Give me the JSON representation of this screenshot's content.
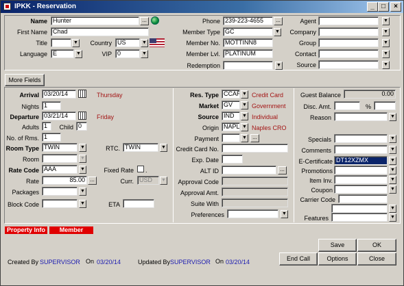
{
  "window": {
    "title": "IPKK - Reservation"
  },
  "profile": {
    "name_label": "Name",
    "name": "Hunter",
    "first_name_label": "First Name",
    "first_name": "Chad",
    "title_label": "Title",
    "title": "",
    "country_label": "Country",
    "country": "US",
    "language_label": "Language",
    "language": "E",
    "vip_label": "VIP",
    "vip": "0",
    "phone_label": "Phone",
    "phone": "239-223-4655",
    "member_type_label": "Member Type",
    "member_type": "GC",
    "member_no_label": "Member No.",
    "member_no": "MOTTINN8",
    "member_lvl_label": "Member Lvl.",
    "member_lvl": "PLATINUM",
    "redemption_label": "Redemption",
    "redemption": "",
    "agent_label": "Agent",
    "agent": "",
    "company_label": "Company",
    "company": "",
    "group_label": "Group",
    "group": "",
    "contact_label": "Contact",
    "contact": "",
    "source_label": "Source",
    "source": ""
  },
  "more_fields_label": "More Fields",
  "stay": {
    "arrival_label": "Arrival",
    "arrival": "03/20/14",
    "arrival_day": "Thursday",
    "nights_label": "Nights",
    "nights": "1",
    "departure_label": "Departure",
    "departure": "03/21/14",
    "departure_day": "Friday",
    "adults_label": "Adults",
    "adults": "1",
    "child_label": "Child",
    "child": "0",
    "rooms_label": "No. of Rms.",
    "rooms": "1",
    "room_type_label": "Room Type",
    "room_type": "TWIN",
    "rtc_label": "RTC.",
    "rtc": "TWIN",
    "room_label": "Room",
    "room": "",
    "rate_code_label": "Rate Code",
    "rate_code": "AAA",
    "fixed_rate_label": "Fixed Rate",
    "fixed_rate_suffix": ".",
    "rate_label": "Rate",
    "rate": "85.00",
    "curr_label": "Curr.",
    "curr": "USD",
    "packages_label": "Packages",
    "packages": "",
    "block_code_label": "Block Code",
    "block_code": "",
    "eta_label": "ETA",
    "eta": ""
  },
  "reservation": {
    "res_type_label": "Res. Type",
    "res_type": "CCAR",
    "res_type_desc": "Credit Card",
    "market_label": "Market",
    "market": "GV",
    "market_desc": "Government",
    "source_label": "Source",
    "source": "IND",
    "source_desc": "Individual",
    "origin_label": "Origin",
    "origin": "NAPL",
    "origin_desc": "Naples CRO",
    "payment_label": "Payment",
    "payment": "",
    "cc_label": "Credit Card No.",
    "cc": "",
    "exp_label": "Exp. Date",
    "exp": "",
    "alt_id_label": "ALT ID",
    "alt_id": "",
    "approval_code_label": "Approval Code",
    "approval_code": "",
    "approval_amt_label": "Approval Amt.",
    "approval_amt": "",
    "suite_with_label": "Suite With",
    "suite_with": "",
    "preferences_label": "Preferences",
    "preferences": ""
  },
  "right": {
    "guest_balance_label": "Guest Balance",
    "guest_balance": "0.00",
    "disc_amt_label": "Disc. Amt.",
    "disc_amt": "",
    "pct_label": "%",
    "pct": "",
    "reason_label": "Reason",
    "reason": "",
    "specials_label": "Specials",
    "specials": "",
    "comments_label": "Comments",
    "comments": "",
    "ecert_label": "E-Certificate",
    "ecert": "DT12XZMX",
    "promotions_label": "Promotions",
    "promotions": "",
    "item_inv_label": "Item Inv.",
    "item_inv": "",
    "coupon_label": "Coupon",
    "coupon": "",
    "carrier_label": "Carrier Code",
    "carrier": "",
    "extra": "",
    "features_label": "Features",
    "features": ""
  },
  "tabs": [
    "Property Info",
    "Member"
  ],
  "footer": {
    "created_by_label": "Created By",
    "created_by": "SUPERVISOR",
    "on_label": "On",
    "created_on": "03/20/14",
    "updated_by_label": "Updated By",
    "updated_by": "SUPERVISOR",
    "updated_on": "03/20/14"
  },
  "buttons": {
    "save": "Save",
    "ok": "OK",
    "end_call": "End Call",
    "options": "Options",
    "close": "Close"
  },
  "colors": {
    "title_bar": "#0a246a",
    "tab_red": "#e00000",
    "desc_red": "#a31515",
    "selected": "#0a246a"
  }
}
